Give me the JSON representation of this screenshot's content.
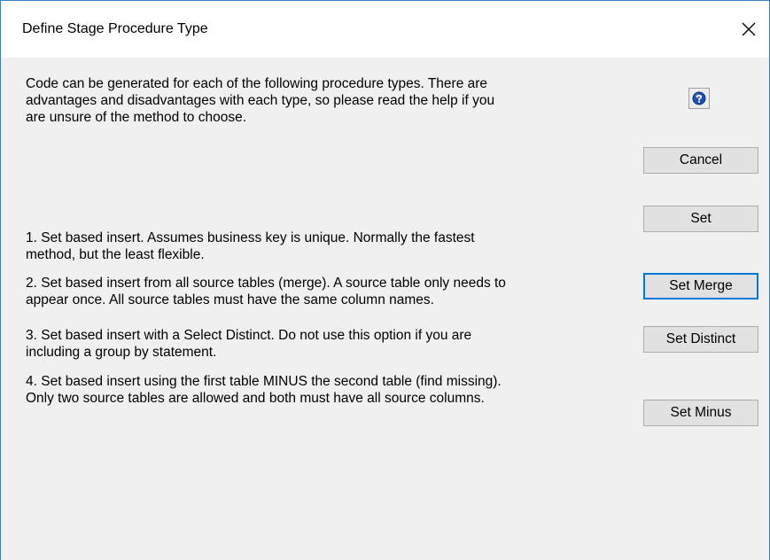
{
  "window": {
    "title": "Define Stage Procedure Type",
    "close_icon": "close-icon"
  },
  "intro_text": "Code can be generated for each of the following procedure types. There are\nadvantages and disadvantages with each type, so please read the help if you\nare unsure of the method to choose.",
  "help_icon": "question-mark-icon",
  "buttons": {
    "cancel": "Cancel",
    "set": "Set",
    "set_merge": "Set Merge",
    "set_distinct": "Set Distinct",
    "set_minus": "Set Minus"
  },
  "options": [
    {
      "text": "1. Set based insert. Assumes business key is unique. Normally the fastest\nmethod, but the least flexible."
    },
    {
      "text": "2. Set based insert from all source tables (merge). A source table only needs to\nappear once. All source tables must have the same column names."
    },
    {
      "text": "3. Set based insert with a Select Distinct.   Do not use this option if you are\nincluding a group by statement."
    },
    {
      "text": "4. Set based insert using the first table MINUS the second table (find missing).\nOnly two source tables are allowed and both must have all source columns."
    }
  ],
  "colors": {
    "accent": "#0078d7",
    "window_border": "#3c7fc3",
    "dialog_bg": "#f0f0f0",
    "help_icon_blue": "#1f4fb4"
  }
}
